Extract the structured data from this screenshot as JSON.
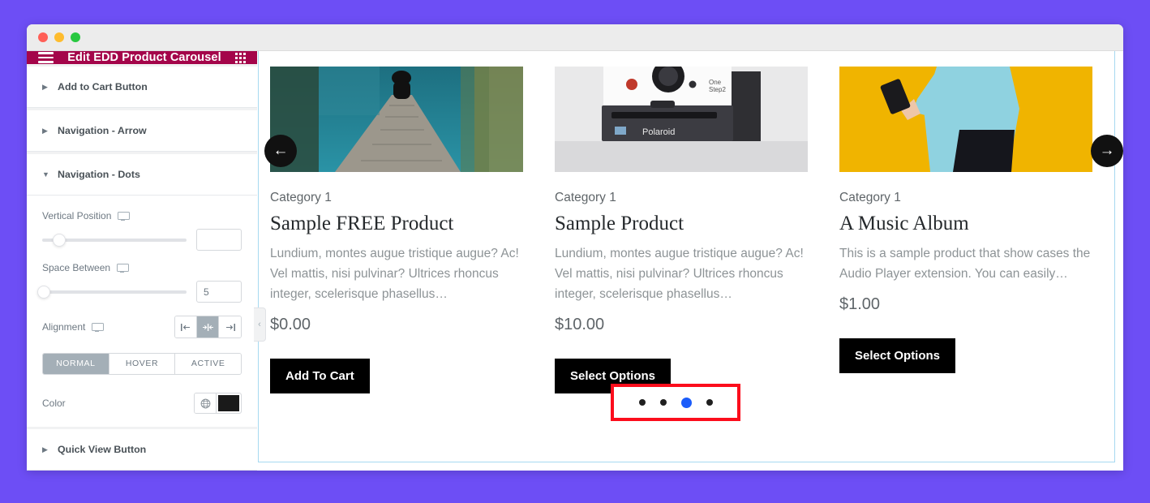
{
  "window": {
    "traffic_lights": [
      "close",
      "minimize",
      "maximize"
    ]
  },
  "panel": {
    "title": "Edit EDD Product Carousel",
    "menu_icon": "hamburger-icon",
    "apps_icon": "grid-icon",
    "collapse_icon": "chevron-left-icon",
    "sections": [
      {
        "label": "Add to Cart Button",
        "expanded": false,
        "caret": "▶"
      },
      {
        "label": "Navigation - Arrow",
        "expanded": false,
        "caret": "▶"
      },
      {
        "label": "Navigation - Dots",
        "expanded": true,
        "caret": "▼"
      },
      {
        "label": "Quick View Button",
        "expanded": false,
        "caret": "▶"
      }
    ],
    "controls": {
      "vertical_position": {
        "label": "Vertical Position",
        "device_icon": "desktop-icon",
        "value": "",
        "knob_percent": 12
      },
      "space_between": {
        "label": "Space Between",
        "device_icon": "desktop-icon",
        "value": "5",
        "knob_percent": 1
      },
      "alignment": {
        "label": "Alignment",
        "device_icon": "desktop-icon",
        "options": [
          "align-left",
          "align-center",
          "align-right"
        ],
        "selected": "align-center"
      },
      "state_tabs": {
        "items": [
          "NORMAL",
          "HOVER",
          "ACTIVE"
        ],
        "selected": "NORMAL"
      },
      "color": {
        "label": "Color",
        "globe_icon": "globe-icon",
        "swatch_hex": "#1a1a1a"
      }
    }
  },
  "preview": {
    "prev_arrow": "arrow-left-icon",
    "next_arrow": "arrow-right-icon",
    "products": [
      {
        "image": "person-sitting-on-dock-lake",
        "category": "Category 1",
        "title": "Sample FREE Product",
        "description": "Lundium, montes augue tristique augue? Ac! Vel mattis, nisi pulvinar? Ultrices rhoncus integer, scelerisque phasellus…",
        "price": "$0.00",
        "button": "Add To Cart"
      },
      {
        "image": "polaroid-onestep2-camera",
        "category": "Category 1",
        "title": "Sample Product",
        "description": "Lundium, montes augue tristique augue? Ac! Vel mattis, nisi pulvinar? Ultrices rhoncus integer, scelerisque phasellus…",
        "price": "$10.00",
        "button": "Select Options"
      },
      {
        "image": "person-holding-phone-yellow-background",
        "category": "Category 1",
        "title": "A Music Album",
        "description": "This is a sample product that show cases the Audio Player extension. You can easily…",
        "price": "$1.00",
        "button": "Select Options"
      }
    ],
    "dots": {
      "count": 4,
      "active_index": 2,
      "highlight_color": "#fc0d1c"
    }
  },
  "colors": {
    "panel_header": "#a4054a",
    "accent_blue": "#1b5cfa",
    "desktop_background": "#6d4ef5"
  }
}
